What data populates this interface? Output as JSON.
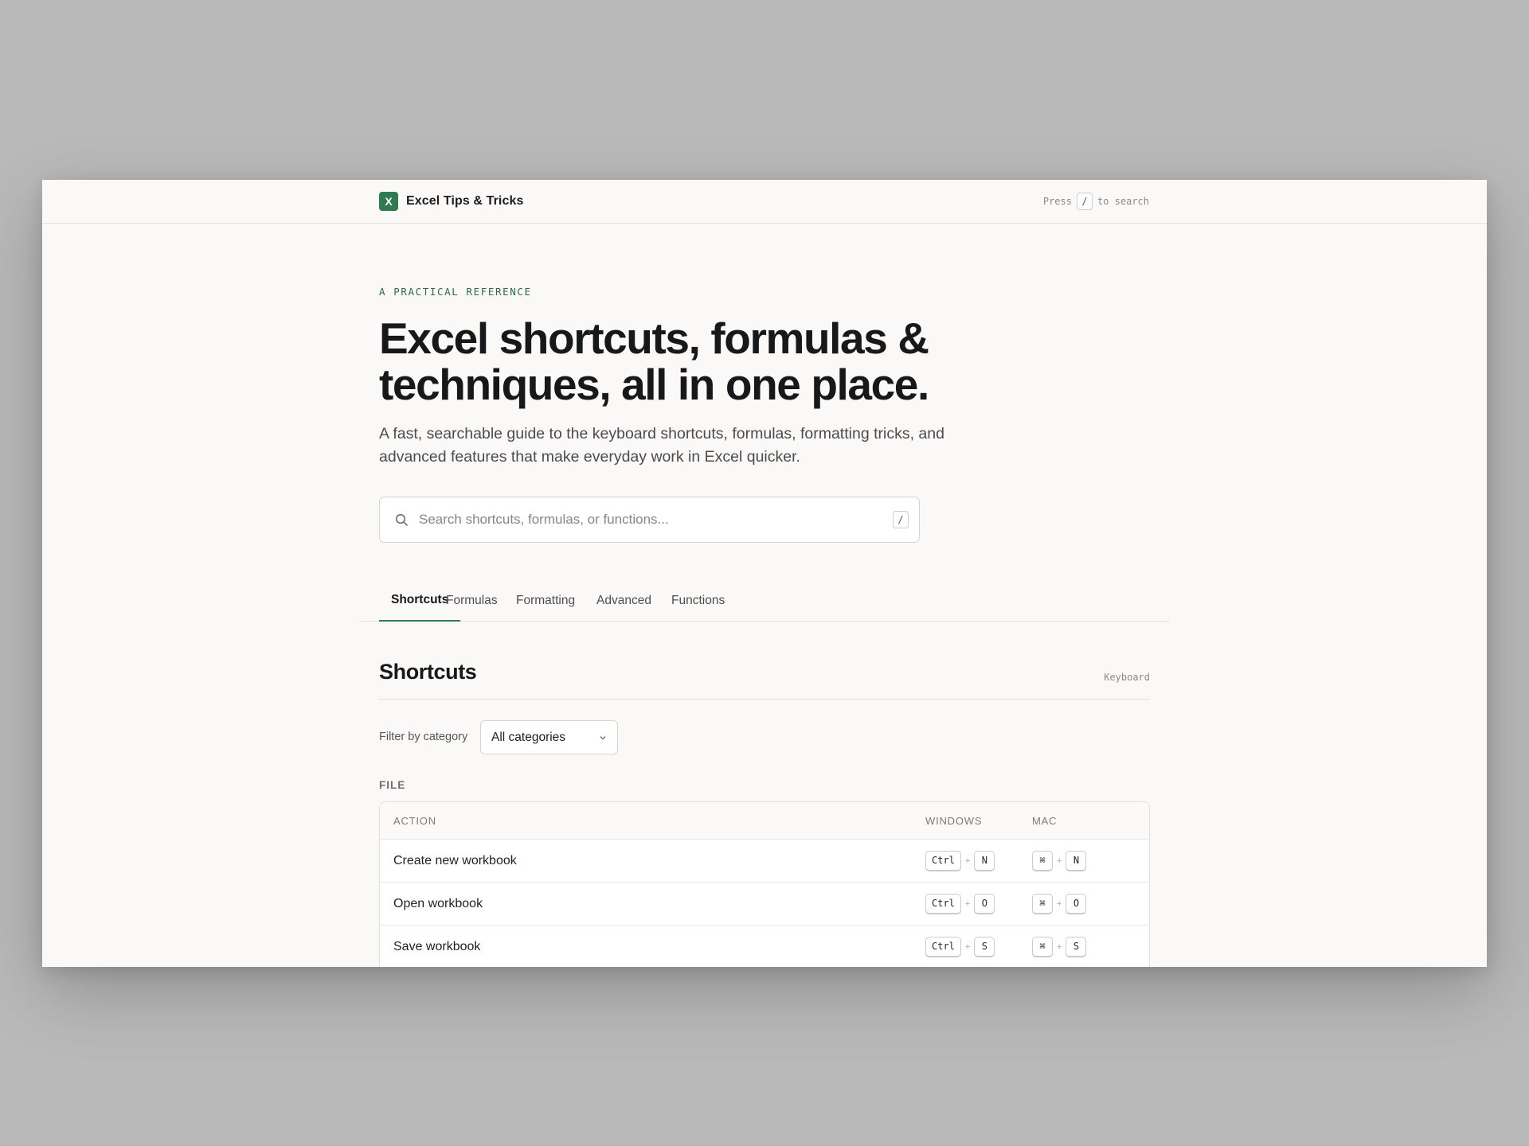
{
  "header": {
    "logo_letter": "X",
    "brand_name": "Excel Tips & Tricks",
    "hint_prefix": "Press",
    "hint_key": "/",
    "hint_suffix": "to search"
  },
  "hero": {
    "eyebrow": "A PRACTICAL REFERENCE",
    "headline": "Excel shortcuts, formulas & techniques, all in one place.",
    "lede": "A fast, searchable guide to the keyboard shortcuts, formulas, formatting tricks, and advanced features that make everyday work in Excel quicker."
  },
  "search": {
    "placeholder": "Search shortcuts, formulas, or functions...",
    "value": "",
    "shortcut_key": "/"
  },
  "tabs": [
    {
      "label": "Shortcuts",
      "active": true
    },
    {
      "label": "Formulas",
      "active": false
    },
    {
      "label": "Formatting",
      "active": false
    },
    {
      "label": "Advanced",
      "active": false
    },
    {
      "label": "Functions",
      "active": false
    }
  ],
  "section": {
    "title": "Shortcuts",
    "tag": "Keyboard",
    "filter_label": "Filter by category",
    "filter_selected": "All categories"
  },
  "table": {
    "group": "FILE",
    "headers": {
      "action": "ACTION",
      "windows": "WINDOWS",
      "mac": "MAC"
    },
    "rows": [
      {
        "action": "Create new workbook",
        "win_mod": "Ctrl",
        "win_key": "N",
        "mac_mod": "⌘",
        "mac_key": "N"
      },
      {
        "action": "Open workbook",
        "win_mod": "Ctrl",
        "win_key": "O",
        "mac_mod": "⌘",
        "mac_key": "O"
      },
      {
        "action": "Save workbook",
        "win_mod": "Ctrl",
        "win_key": "S",
        "mac_mod": "⌘",
        "mac_key": "S"
      }
    ],
    "plus": "+"
  },
  "colors": {
    "accent": "#2f7a4f",
    "eyebrow": "#2f6b47",
    "page_bg": "#faf9f7",
    "backdrop": "#b9b9b9"
  }
}
